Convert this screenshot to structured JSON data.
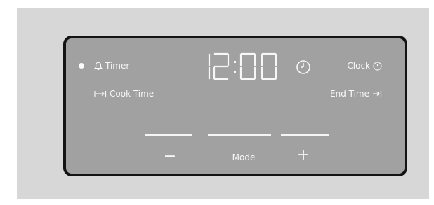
{
  "panel": {
    "timer_label": "Timer",
    "cook_time_label": "Cook Time",
    "clock_label": "Clock",
    "end_time_label": "End Time",
    "time_display": "12:00",
    "minus_label": "−",
    "mode_label": "Mode",
    "plus_label": "+"
  },
  "icons": {
    "indicator": "indicator-dot-icon",
    "timer": "bell-icon",
    "cook_time": "cook-time-arrow-icon",
    "clock": "clock-icon",
    "end_time": "end-time-arrow-icon",
    "display_clock": "clock-icon"
  },
  "colors": {
    "frame": "#d7d7d7",
    "panel": "#a1a1a1",
    "border": "#131313",
    "text": "#f7f7f7"
  }
}
